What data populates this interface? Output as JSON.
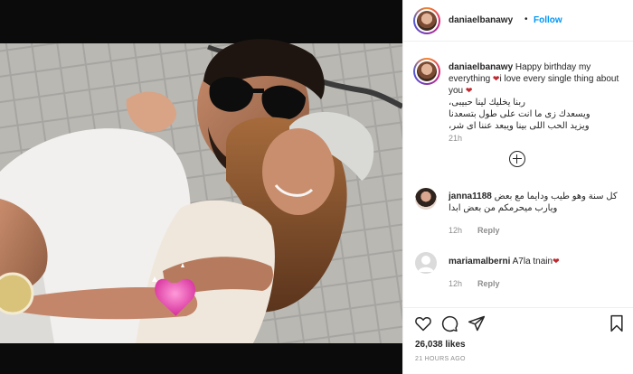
{
  "post": {
    "author": "daniaelbanawy",
    "follow_label": "Follow",
    "separator": "•"
  },
  "caption": {
    "user": "daniaelbanawy",
    "line1": "Happy birthday my everything",
    "line1b": "i love every single thing about you",
    "arabic1": "ربنا يخليك لينا حبيبى،",
    "arabic2": "ويسعدك زى ما انت على طول بتسعدنا",
    "arabic3": "ويزيد الحب اللى بينا ويبعد عننا اى شر،",
    "heart": "❤",
    "time": "21h"
  },
  "comments": [
    {
      "user": "janna1188",
      "text": "كل سنة وهو طيب ودايما مع بعض ويارب ميحرمكم من بعض ابدا",
      "time": "12h",
      "reply": "Reply"
    },
    {
      "user": "mariamalberni",
      "text": "A7la tnain",
      "heart": "❤",
      "time": "12h",
      "reply": "Reply"
    }
  ],
  "actions": {
    "icons": [
      "heart-icon",
      "comment-icon",
      "share-icon",
      "bookmark-icon"
    ],
    "likes": "26,038 likes",
    "ago": "21 HOURS AGO"
  },
  "colors": {
    "link_blue": "#0095f6",
    "heart_red": "#c1272d",
    "muted_gray": "#8e8e8e",
    "text": "#262626"
  }
}
